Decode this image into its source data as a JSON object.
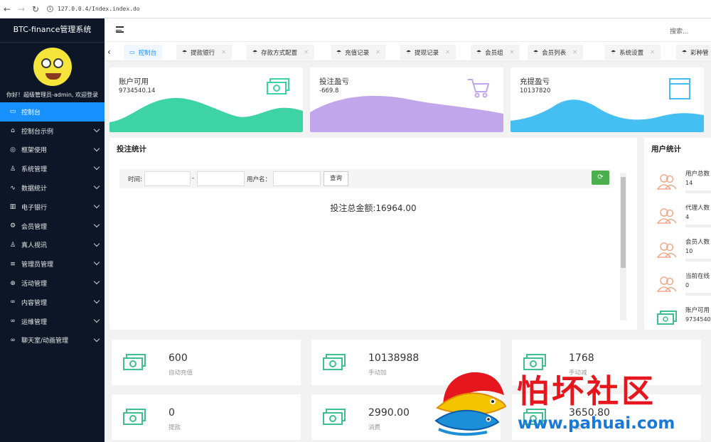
{
  "browser": {
    "url": "127.0.0.4/Index.index.do"
  },
  "sidebar": {
    "title": "BTC-finance管理系统",
    "welcome": "你好！超级管理员-admin, 欢迎登录",
    "items": [
      {
        "label": "控制台",
        "icon": "monitor-icon",
        "active": true
      },
      {
        "label": "控制台示例",
        "icon": "home-icon"
      },
      {
        "label": "框架使用",
        "icon": "layers-icon"
      },
      {
        "label": "系统管理",
        "icon": "user-icon"
      },
      {
        "label": "数据统计",
        "icon": "pulse-icon"
      },
      {
        "label": "电子银行",
        "icon": "bank-icon"
      },
      {
        "label": "会员管理",
        "icon": "gear-icon"
      },
      {
        "label": "真人视讯",
        "icon": "person-icon"
      },
      {
        "label": "管理员管理",
        "icon": "list-icon"
      },
      {
        "label": "活动管理",
        "icon": "plus-circle-icon"
      },
      {
        "label": "内容管理",
        "icon": "link-icon"
      },
      {
        "label": "运维管理",
        "icon": "link-icon"
      },
      {
        "label": "聊天室/动画管理",
        "icon": "link-icon"
      }
    ]
  },
  "topbar": {
    "search_label": "搜索..."
  },
  "tabs": [
    {
      "label": "控制台",
      "active": true
    },
    {
      "label": "提款银行"
    },
    {
      "label": "存款方式配置"
    },
    {
      "label": "充值记录"
    },
    {
      "label": "提现记录"
    },
    {
      "label": "会员组"
    },
    {
      "label": "会员列表"
    },
    {
      "label": "系统设置"
    },
    {
      "label": "彩种管"
    }
  ],
  "stats": [
    {
      "title": "账户可用",
      "value": "9734540.14",
      "color": "#3dd3a4",
      "icon": "money-icon"
    },
    {
      "title": "投注盈亏",
      "value": "-669.8",
      "color": "#c2a6ec",
      "icon": "cart-icon"
    },
    {
      "title": "充提盈亏",
      "value": "10137820",
      "color": "#45bff2",
      "icon": "browser-icon"
    }
  ],
  "bet_panel": {
    "title": "投注统计",
    "time_label": "时间:",
    "dash": "-",
    "username_label": "用户名：",
    "query_button": "查询",
    "total_text": "投注总金额:16964.00"
  },
  "user_panel": {
    "title": "用户统计",
    "items": [
      {
        "label": "用户总数",
        "value": "14"
      },
      {
        "label": "代理人数",
        "value": "4"
      },
      {
        "label": "会员人数",
        "value": "10"
      },
      {
        "label": "当前在线",
        "value": "0"
      },
      {
        "label": "账户可用",
        "value": "9734540."
      }
    ]
  },
  "metrics": [
    {
      "value": "600",
      "label": "自动充值"
    },
    {
      "value": "10138988",
      "label": "手动加"
    },
    {
      "value": "1768",
      "label": "手动减"
    },
    {
      "value": "0",
      "label": "提款"
    },
    {
      "value": "2990.00",
      "label": "消费"
    },
    {
      "value": "3650.80",
      "label": "中奖"
    }
  ],
  "watermark": {
    "title": "怕坏社区",
    "url": "www.pahuai.com"
  }
}
